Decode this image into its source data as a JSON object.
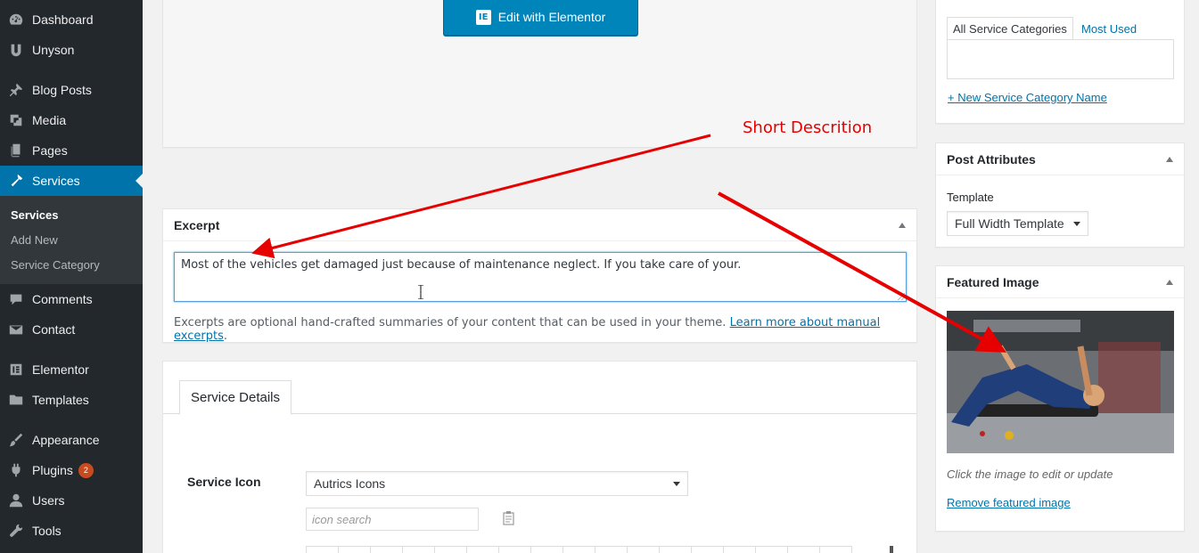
{
  "sidebar": {
    "items": [
      {
        "label": "Dashboard",
        "icon": "dashboard-icon"
      },
      {
        "label": "Unyson",
        "icon": "unyson-icon"
      },
      {
        "label": "Blog Posts",
        "icon": "pushpin-icon"
      },
      {
        "label": "Media",
        "icon": "media-icon"
      },
      {
        "label": "Pages",
        "icon": "pages-icon"
      },
      {
        "label": "Services",
        "icon": "hammer-icon"
      },
      {
        "label": "Comments",
        "icon": "comment-icon"
      },
      {
        "label": "Contact",
        "icon": "envelope-icon"
      },
      {
        "label": "Elementor",
        "icon": "elementor-icon"
      },
      {
        "label": "Templates",
        "icon": "folder-icon"
      },
      {
        "label": "Appearance",
        "icon": "brush-icon"
      },
      {
        "label": "Plugins",
        "icon": "plugin-icon",
        "badge": "2"
      },
      {
        "label": "Users",
        "icon": "users-icon"
      },
      {
        "label": "Tools",
        "icon": "wrench-icon"
      }
    ],
    "submenu": [
      {
        "label": "Services"
      },
      {
        "label": "Add New"
      },
      {
        "label": "Service Category"
      }
    ]
  },
  "elementor": {
    "button_label": "Edit with Elementor"
  },
  "excerpt": {
    "title": "Excerpt",
    "value": "Most of the vehicles get damaged just because of maintenance neglect. If you take care of your.",
    "help_text": "Excerpts are optional hand-crafted summaries of your content that can be used in your theme.",
    "help_link": "Learn more about manual excerpts",
    "help_end": "."
  },
  "service_details": {
    "tab_label": "Service Details",
    "icon_label": "Service Icon",
    "icon_select_value": "Autrics Icons",
    "icon_search_placeholder": "icon search"
  },
  "categories": {
    "tab_all": "All Service Categories",
    "tab_used": "Most Used",
    "add_link": "+ New Service Category Name"
  },
  "post_attributes": {
    "title": "Post Attributes",
    "template_label": "Template",
    "template_value": "Full Width Template"
  },
  "featured_image": {
    "title": "Featured Image",
    "hint": "Click the image to edit or update",
    "remove_link": "Remove featured image"
  },
  "annotation": {
    "label": "Short Descrition",
    "color": "#e60000"
  },
  "colors": {
    "accent": "#0073aa",
    "sidebar_bg": "#23282d",
    "button": "#0085ba"
  }
}
